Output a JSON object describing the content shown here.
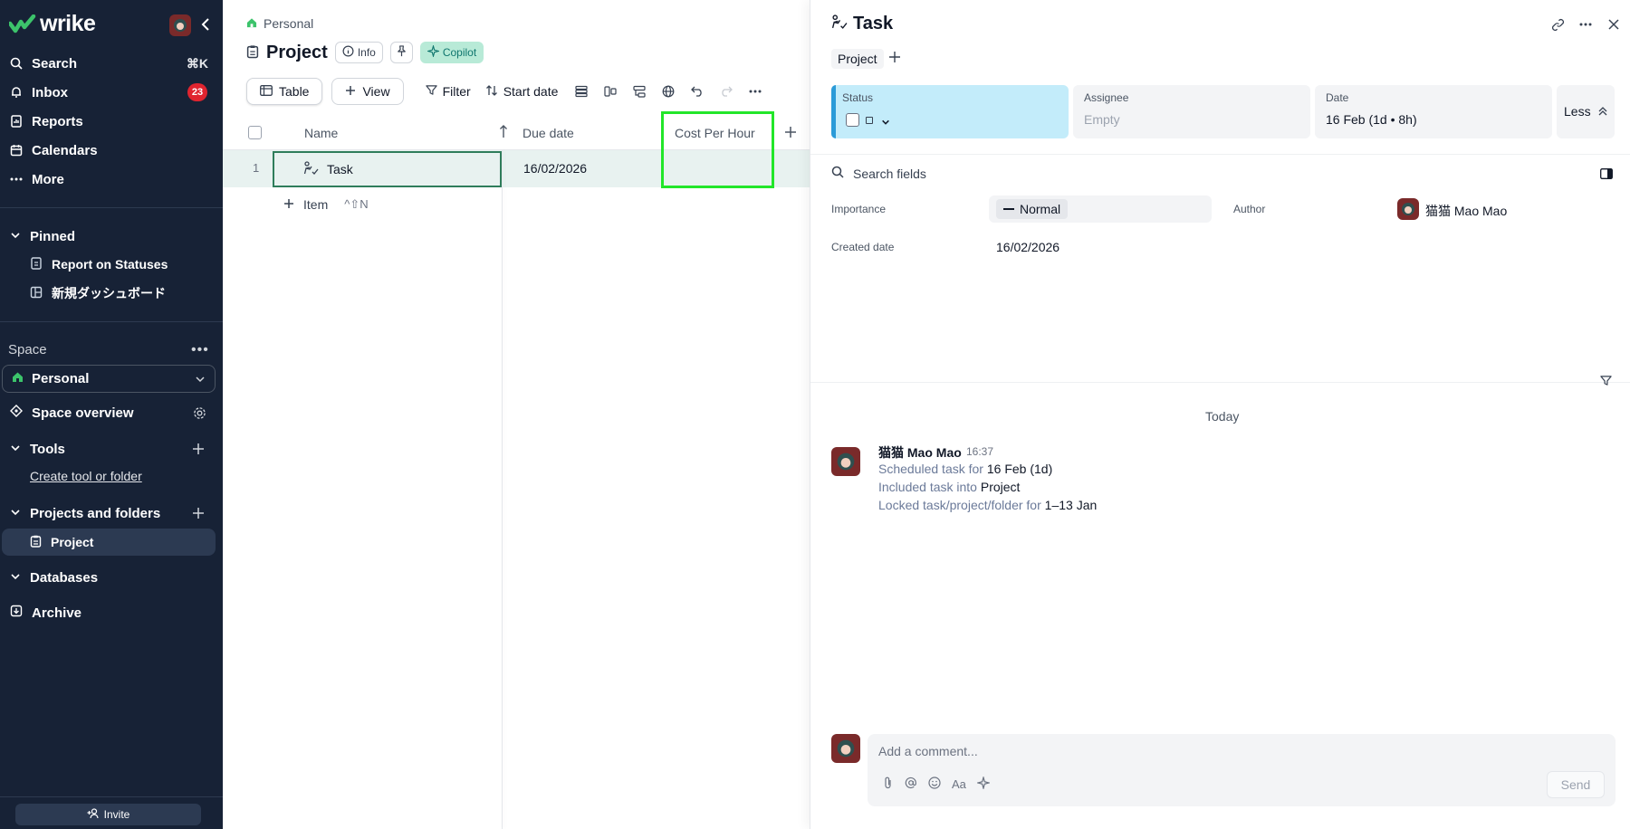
{
  "sidebar": {
    "logo": "wrike",
    "nav": [
      {
        "label": "Search",
        "shortcut": "⌘K"
      },
      {
        "label": "Inbox",
        "badge": "23"
      },
      {
        "label": "Reports"
      },
      {
        "label": "Calendars"
      },
      {
        "label": "More"
      }
    ],
    "pinned": {
      "title": "Pinned",
      "items": [
        "Report on Statuses",
        "新規ダッシュボード"
      ]
    },
    "space": {
      "label": "Space",
      "selected": "Personal",
      "overview": "Space overview"
    },
    "tools": {
      "title": "Tools",
      "create_link": "Create tool or folder"
    },
    "projects": {
      "title": "Projects and folders",
      "items": [
        "Project"
      ]
    },
    "databases": "Databases",
    "archive": "Archive",
    "invite": "Invite"
  },
  "main": {
    "breadcrumb": "Personal",
    "title": "Project",
    "info_label": "Info",
    "copilot_label": "Copilot",
    "toolbar": {
      "table": "Table",
      "view": "View",
      "filter": "Filter",
      "sort": "Start date"
    },
    "columns": [
      "Name",
      "Due date",
      "Cost Per Hour"
    ],
    "rows": [
      {
        "num": "1",
        "name": "Task",
        "due": "16/02/2026",
        "cost": ""
      }
    ],
    "add_item": {
      "label": "Item",
      "shortcut": "^⇧N"
    }
  },
  "panel": {
    "title": "Task",
    "tag": "Project",
    "fields": {
      "status": {
        "label": "Status"
      },
      "assignee": {
        "label": "Assignee",
        "value": "Empty"
      },
      "date": {
        "label": "Date",
        "value": "16 Feb (1d • 8h)"
      },
      "less": "Less"
    },
    "search_placeholder": "Search fields",
    "importance": {
      "label": "Importance",
      "value": "Normal"
    },
    "author": {
      "label": "Author",
      "value": "猫猫 Mao Mao"
    },
    "created": {
      "label": "Created date",
      "value": "16/02/2026"
    },
    "activity": {
      "day": "Today",
      "user": "猫猫 Mao Mao",
      "time": "16:37",
      "lines": [
        {
          "text": "Scheduled task for",
          "value": "16 Feb (1d)"
        },
        {
          "text": "Included task into",
          "value": "Project"
        },
        {
          "text": "Locked task/project/folder for",
          "value": "1–13 Jan"
        }
      ]
    },
    "comment_placeholder": "Add a comment...",
    "send": "Send",
    "format_label": "Aa"
  },
  "colors": {
    "sidebar_bg": "#172236",
    "status_bg": "#c3ecfa",
    "highlight": "#22e629",
    "selected_border": "#2f7d5b"
  }
}
